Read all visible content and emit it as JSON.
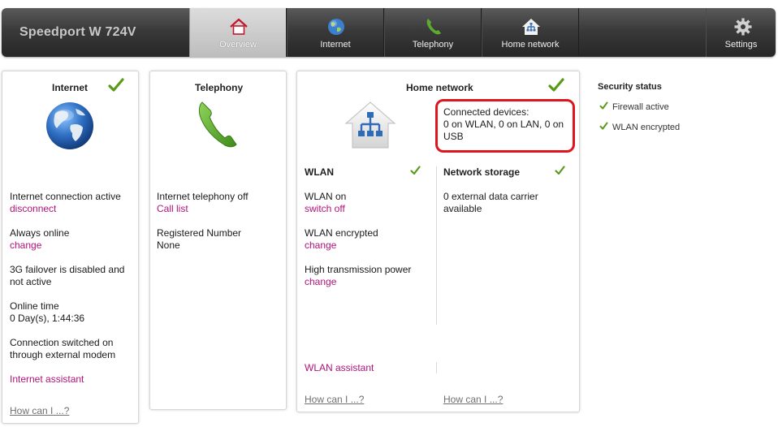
{
  "header": {
    "brand": "Speedport W 724V",
    "tabs": [
      {
        "label": "Overview",
        "icon": "house-icon",
        "active": true
      },
      {
        "label": "Internet",
        "icon": "globe-icon",
        "active": false
      },
      {
        "label": "Telephony",
        "icon": "phone-icon",
        "active": false
      },
      {
        "label": "Home network",
        "icon": "network-house-icon",
        "active": false
      },
      {
        "label": "Settings",
        "icon": "gear-icon",
        "active": false
      }
    ]
  },
  "colors": {
    "link": "#b0127a",
    "check": "#5a9a1a",
    "highlight": "#e0141c",
    "topbar": "#333333"
  },
  "internet": {
    "title": "Internet",
    "status": "Internet connection active",
    "status_action": "disconnect",
    "mode": "Always online",
    "mode_action": "change",
    "failover": "3G failover is disabled and",
    "failover_2": "not active",
    "online_time_label": "Online time",
    "online_time": "0 Day(s), 1:44:36",
    "connection_1": "Connection switched on",
    "connection_2": "through external modem",
    "assistant": "Internet assistant",
    "help": "How can I ...?"
  },
  "telephony": {
    "title": "Telephony",
    "status": "Internet telephony off",
    "calllist": "Call list",
    "registered_label": "Registered Number",
    "registered_value": "None"
  },
  "home_network": {
    "title": "Home network",
    "connected_label": "Connected devices:",
    "connected_line1": "0 on WLAN, 0 on LAN, 0 on",
    "connected_line2": "USB",
    "wlan": {
      "title": "WLAN",
      "status": "WLAN on",
      "status_action": "switch off",
      "encryption": "WLAN encrypted",
      "encryption_action": "change",
      "power": "High transmission power",
      "power_action": "change",
      "assistant": "WLAN assistant",
      "help": "How can I ...?"
    },
    "storage": {
      "title": "Network storage",
      "line1": "0 external data carrier",
      "line2": "available",
      "help": "How can I ...?"
    }
  },
  "security": {
    "title": "Security status",
    "items": [
      "Firewall active",
      "WLAN encrypted"
    ]
  }
}
